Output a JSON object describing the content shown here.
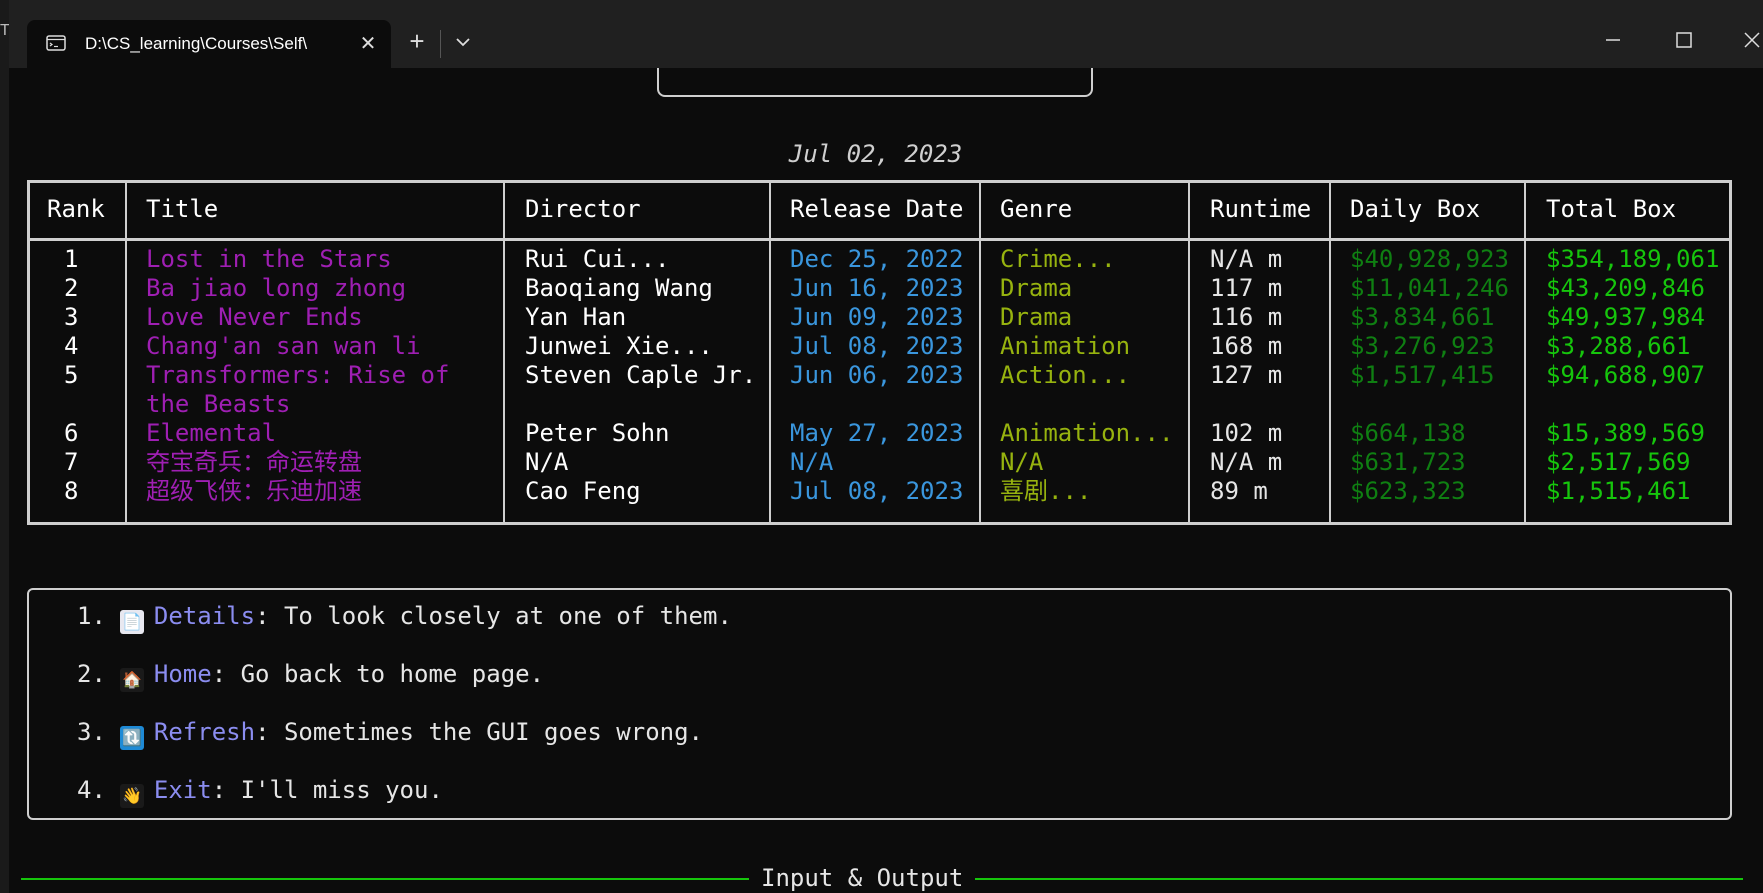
{
  "left_window": {
    "glyph": "T"
  },
  "titlebar": {
    "tab_title": "D:\\CS_learning\\Courses\\Self\\",
    "new_tab": "+",
    "close_tab": "✕"
  },
  "date": "Jul 02, 2023",
  "table": {
    "headers": [
      "Rank",
      "Title",
      "Director",
      "Release Date",
      "Genre",
      "Runtime",
      "Daily Box",
      "Total Box"
    ],
    "rows": [
      {
        "rank": "1",
        "title": "Lost in the Stars",
        "director": "Rui Cui...",
        "release": "Dec 25, 2022",
        "genre": "Crime...",
        "runtime": "N/A m",
        "daily": "$40,928,923",
        "total": "$354,189,061"
      },
      {
        "rank": "2",
        "title": "Ba jiao long zhong",
        "director": "Baoqiang Wang",
        "release": "Jun 16, 2023",
        "genre": "Drama",
        "runtime": "117 m",
        "daily": "$11,041,246",
        "total": "$43,209,846"
      },
      {
        "rank": "3",
        "title": "Love Never Ends",
        "director": "Yan Han",
        "release": "Jun 09, 2023",
        "genre": "Drama",
        "runtime": "116 m",
        "daily": "$3,834,661",
        "total": "$49,937,984"
      },
      {
        "rank": "4",
        "title": "Chang'an san wan li",
        "director": "Junwei Xie...",
        "release": "Jul 08, 2023",
        "genre": "Animation",
        "runtime": "168 m",
        "daily": "$3,276,923",
        "total": "$3,288,661"
      },
      {
        "rank": "5",
        "title": "Transformers: Rise of the Beasts",
        "director": "Steven Caple Jr.",
        "release": "Jun 06, 2023",
        "genre": "Action...",
        "runtime": "127 m",
        "daily": "$1,517,415",
        "total": "$94,688,907"
      },
      {
        "rank": "6",
        "title": "Elemental",
        "director": "Peter Sohn",
        "release": "May 27, 2023",
        "genre": "Animation...",
        "runtime": "102 m",
        "daily": "$664,138",
        "total": "$15,389,569"
      },
      {
        "rank": "7",
        "title": "夺宝奇兵：命运转盘",
        "director": "N/A",
        "release": "N/A",
        "genre": "N/A",
        "runtime": "N/A m",
        "daily": "$631,723",
        "total": "$2,517,569"
      },
      {
        "rank": "8",
        "title": "超级飞侠：乐迪加速",
        "director": "Cao Feng",
        "release": "Jul 08, 2023",
        "genre": "喜剧...",
        "runtime": "89 m",
        "daily": "$623,323",
        "total": "$1,515,461"
      }
    ]
  },
  "menu": [
    {
      "num": "1.",
      "emoji": "📄",
      "key": "Details",
      "desc": ": To look closely at one of them."
    },
    {
      "num": "2.",
      "emoji": "🏠",
      "key": "Home",
      "desc": ": Go back to home page."
    },
    {
      "num": "3.",
      "emoji": "🔃",
      "key": "Refresh",
      "desc": ": Sometimes the GUI goes wrong."
    },
    {
      "num": "4.",
      "emoji": "👋",
      "key": "Exit",
      "desc": ": I'll miss you."
    }
  ],
  "footer": {
    "label": "Input & Output"
  },
  "colors": {
    "title": "#9f1fb3",
    "release": "#3a96dd",
    "genre": "#97b30f",
    "daily": "#0f7f12",
    "total": "#16c60c",
    "menu_key": "#8b8df0"
  }
}
